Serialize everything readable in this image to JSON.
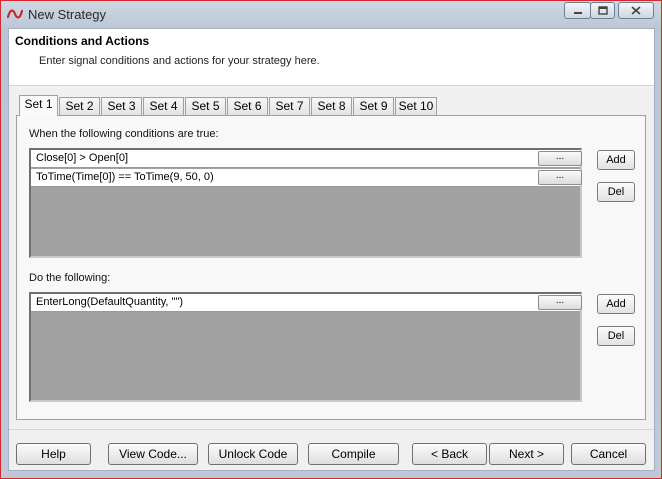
{
  "window": {
    "title": "New Strategy"
  },
  "header": {
    "title": "Conditions and Actions",
    "subtitle": "Enter signal conditions and actions for your strategy here."
  },
  "tabs": [
    "Set 1",
    "Set 2",
    "Set 3",
    "Set 4",
    "Set 5",
    "Set 6",
    "Set 7",
    "Set 8",
    "Set 9",
    "Set 10"
  ],
  "conditions": {
    "label": "When the following conditions are true:",
    "items": [
      "Close[0] > Open[0]",
      "ToTime(Time[0]) == ToTime(9, 50, 0)"
    ],
    "add_label": "Add",
    "del_label": "Del"
  },
  "actions": {
    "label": "Do the following:",
    "items": [
      "EnterLong(DefaultQuantity, \"\")"
    ],
    "add_label": "Add",
    "del_label": "Del"
  },
  "row_button_label": "...",
  "footer": {
    "help": "Help",
    "view_code": "View Code...",
    "unlock_code": "Unlock Code",
    "compile": "Compile",
    "back": "< Back",
    "next": "Next >",
    "cancel": "Cancel"
  },
  "colors": {
    "accent_border": "#d9262b",
    "list_bg": "#a2a2a2"
  }
}
